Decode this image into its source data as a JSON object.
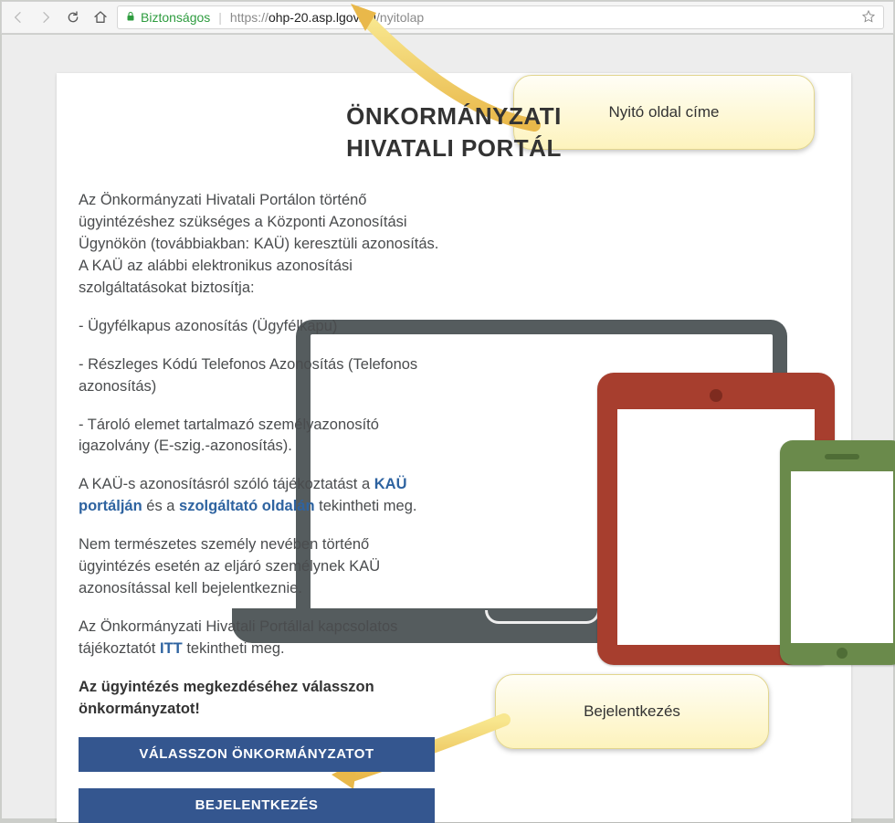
{
  "browser": {
    "secure_label": "Biztonságos",
    "url_protocol": "https://",
    "url_host": "ohp-20.asp.lgov.hu",
    "url_path": "/nyitolap"
  },
  "page": {
    "title_line1": "ÖNKORMÁNYZATI",
    "title_line2": "HIVATALI PORTÁL",
    "intro": "Az Önkormányzati Hivatali Portálon történő ügyintézéshez szükséges a Központi Azonosítási Ügynökön (továbbiakban: KAÜ) keresztüli azonosítás. A KAÜ az alábbi elektronikus azonosítási szolgáltatásokat biztosítja:",
    "li1": "- Ügyfélkapus azonosítás (Ügyfélkapu)",
    "li2": "- Részleges Kódú Telefonos Azonosítás (Telefonos azonosítás)",
    "li3": "- Tároló elemet tartalmazó személyazonosító igazolvány (E-szig.-azonosítás).",
    "para2_pre": "A KAÜ-s azonosításról szóló tájékoztatást a ",
    "link1": "KAÜ portálján",
    "para2_mid": " és a ",
    "link2": "szolgáltató oldalán",
    "para2_post": " tekintheti meg.",
    "para3": "Nem természetes személy nevében történő ügyintézés esetén az eljáró személynek KAÜ azonosítással kell bejelentkeznie.",
    "para4_pre": "Az Önkormányzati Hivatali Portállal kapcsolatos tájékoztatót ",
    "link3": "ITT",
    "para4_post": " tekintheti meg.",
    "cta_text": "Az ügyintézés megkezdéséhez válasszon önkormányzatot!",
    "btn_select": "VÁLASSZON ÖNKORMÁNYZATOT",
    "btn_login": "BEJELENTKEZÉS"
  },
  "callouts": {
    "top": "Nyitó oldal címe",
    "bottom": "Bejelentkezés"
  },
  "colors": {
    "primary_button": "#34568f",
    "tablet": "#a73e2e",
    "phone": "#6a8a4b"
  }
}
